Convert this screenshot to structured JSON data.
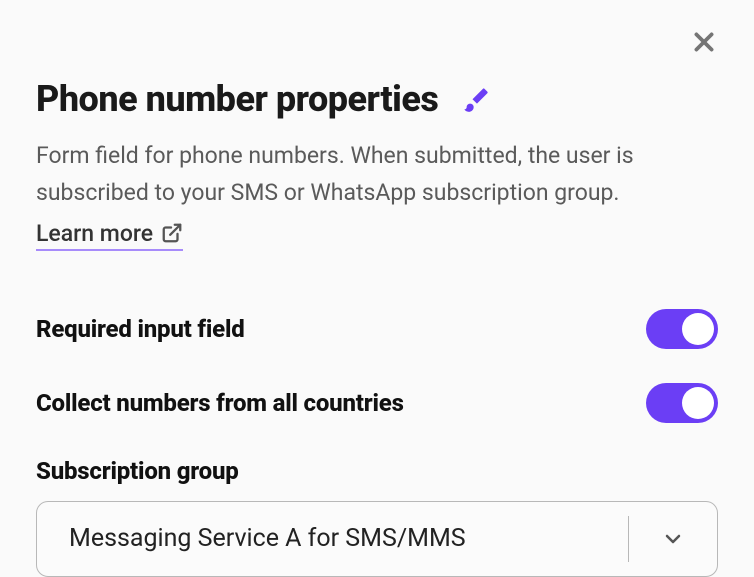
{
  "header": {
    "title": "Phone number properties",
    "description": "Form field for phone numbers. When submitted, the user is subscribed to your SMS or WhatsApp subscription group.",
    "learn_more": "Learn more"
  },
  "options": {
    "required_label": "Required input field",
    "required_on": true,
    "collect_all_label": "Collect numbers from all countries",
    "collect_all_on": true
  },
  "subscription": {
    "label": "Subscription group",
    "selected": "Messaging Service A for SMS/MMS"
  },
  "icons": {
    "close": "close-icon",
    "brush": "brush-icon",
    "external": "external-link-icon",
    "chevron_down": "chevron-down-icon"
  },
  "colors": {
    "accent": "#6b3ef5",
    "link_underline": "#a78bfa"
  }
}
